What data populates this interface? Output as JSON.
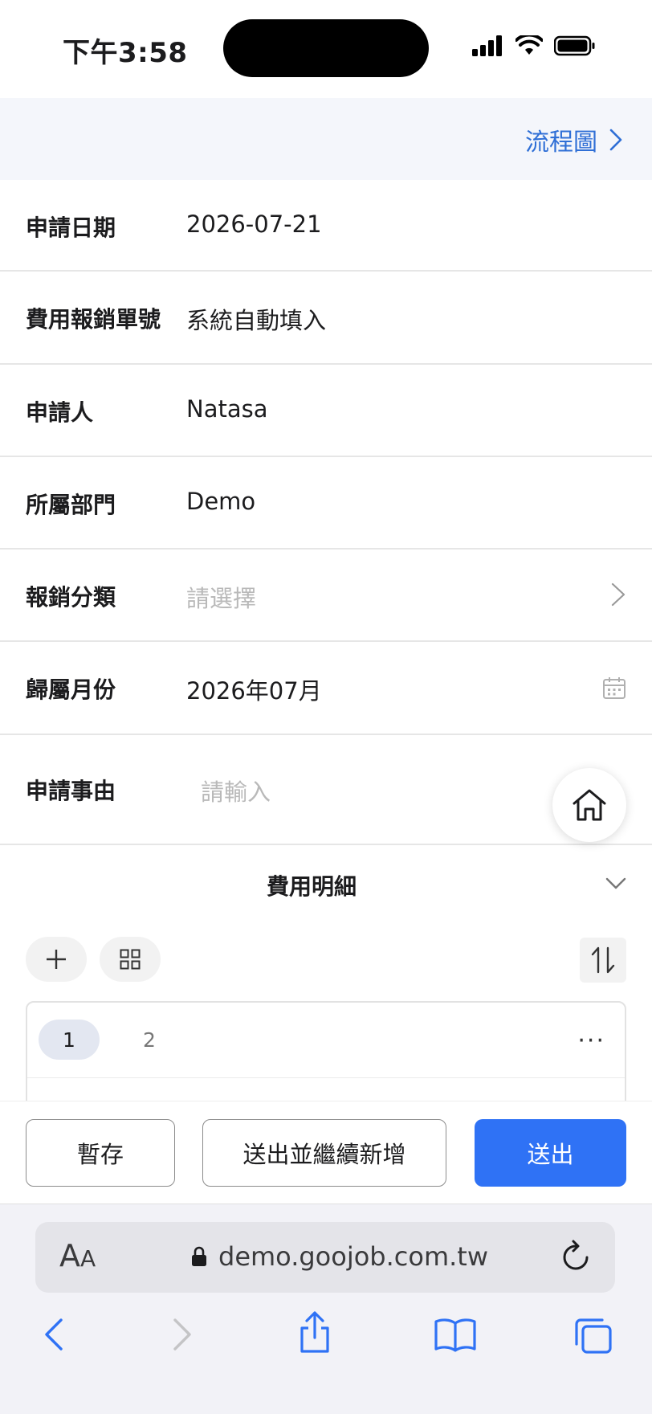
{
  "status_bar": {
    "time": "下午3:58"
  },
  "flow": {
    "link_label": "流程圖"
  },
  "form": {
    "apply_date": {
      "label": "申請日期",
      "value": "2026-07-21"
    },
    "form_no": {
      "label": "費用報銷單號",
      "value": "系統自動填入"
    },
    "applicant": {
      "label": "申請人",
      "value": "Natasa"
    },
    "department": {
      "label": "所屬部門",
      "value": "Demo"
    },
    "category": {
      "label": "報銷分類",
      "placeholder": "請選擇"
    },
    "month": {
      "label": "歸屬月份",
      "value": "2026年07月"
    },
    "reason": {
      "label": "申請事由",
      "placeholder": "請輸入"
    }
  },
  "details": {
    "title": "費用明細",
    "pages": [
      "1",
      "2"
    ],
    "more": "···"
  },
  "actions": {
    "save_draft": "暫存",
    "submit_continue": "送出並繼續新增",
    "submit": "送出"
  },
  "browser": {
    "aa_large": "A",
    "aa_small": "A",
    "url": "demo.goojob.com.tw"
  },
  "colors": {
    "accent": "#2f72f5",
    "link": "#2f6fd6",
    "placeholder": "#b9b9b9"
  },
  "icons": [
    "signal-icon",
    "wifi-icon",
    "battery-icon",
    "chevron-right-icon",
    "calendar-icon",
    "home-icon",
    "chevron-down-icon",
    "plus-icon",
    "grid-icon",
    "sort-icon",
    "lock-icon",
    "reload-icon",
    "back-icon",
    "forward-icon",
    "share-icon",
    "bookmarks-icon",
    "tabs-icon"
  ]
}
